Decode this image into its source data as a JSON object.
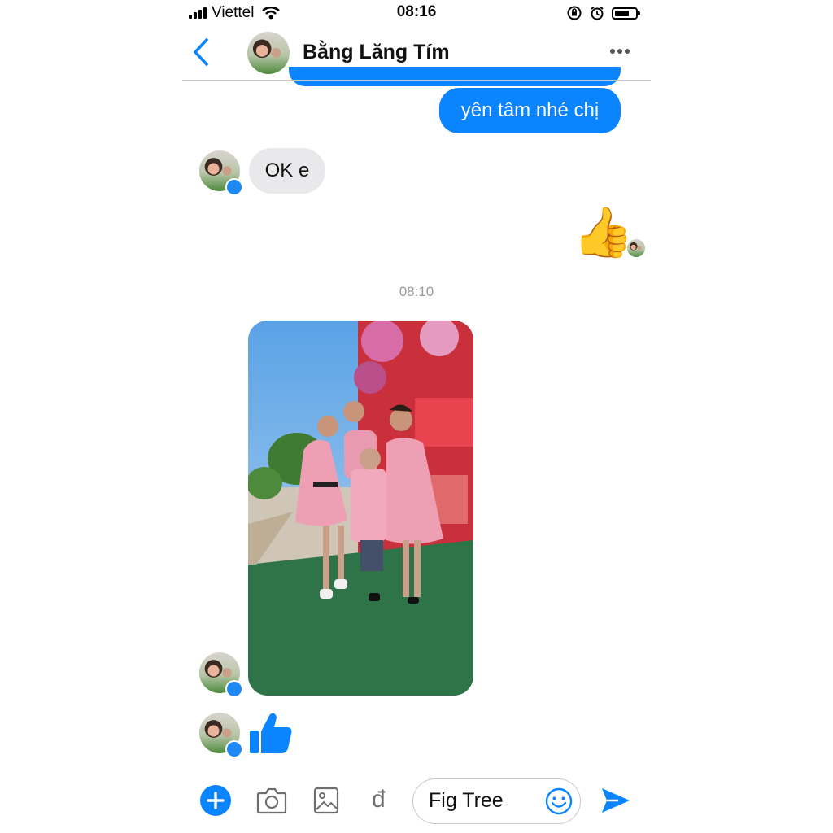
{
  "status_bar": {
    "carrier": "Viettel",
    "time": "08:16",
    "signal_bars": 4,
    "wifi_icon": "wifi-icon",
    "orientation_lock_icon": "orientation-lock-icon",
    "alarm_icon": "alarm-icon",
    "battery_level": 0.7
  },
  "header": {
    "back_icon": "chevron-left-icon",
    "contact_name": "Bằng Lăng Tím",
    "more_icon": "more-dots-icon"
  },
  "messages": {
    "sent_text": "yên tâm nhé chị",
    "received_text": "OK e",
    "sent_reaction": "👍",
    "timestamp": "08:10",
    "received_photo_alt": "photo",
    "received_like_icon": "thumbs-up-icon"
  },
  "composer": {
    "plus_icon": "plus-icon",
    "camera_icon": "camera-icon",
    "gallery_icon": "image-icon",
    "payment_label": "đ",
    "input_value": "Fig Tree",
    "emoji_icon": "smiley-icon",
    "send_icon": "send-icon"
  },
  "colors": {
    "accent": "#0a84ff",
    "received_bubble": "#e9e9eb",
    "timestamp": "#9a9a9a"
  }
}
